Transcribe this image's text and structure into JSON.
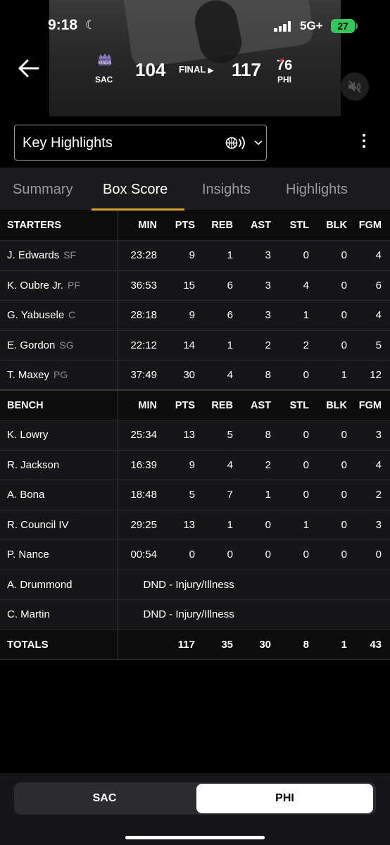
{
  "status": {
    "time": "9:18",
    "network": "5G+",
    "battery": "27"
  },
  "game": {
    "away_abbr": "SAC",
    "away_score": "104",
    "status": "FINAL",
    "home_score": "117",
    "home_abbr": "PHI"
  },
  "dropdown": {
    "label": "Key Highlights"
  },
  "tabs": [
    "Summary",
    "Box Score",
    "Insights",
    "Highlights"
  ],
  "columns": [
    "MIN",
    "PTS",
    "REB",
    "AST",
    "STL",
    "BLK",
    "FGM"
  ],
  "starters_label": "STARTERS",
  "starters": [
    {
      "name": "J. Edwards",
      "pos": "SF",
      "stats": [
        "23:28",
        "9",
        "1",
        "3",
        "0",
        "0",
        "4"
      ]
    },
    {
      "name": "K. Oubre Jr.",
      "pos": "PF",
      "stats": [
        "36:53",
        "15",
        "6",
        "3",
        "4",
        "0",
        "6"
      ]
    },
    {
      "name": "G. Yabusele",
      "pos": "C",
      "stats": [
        "28:18",
        "9",
        "6",
        "3",
        "1",
        "0",
        "4"
      ]
    },
    {
      "name": "E. Gordon",
      "pos": "SG",
      "stats": [
        "22:12",
        "14",
        "1",
        "2",
        "2",
        "0",
        "5"
      ]
    },
    {
      "name": "T. Maxey",
      "pos": "PG",
      "stats": [
        "37:49",
        "30",
        "4",
        "8",
        "0",
        "1",
        "12"
      ]
    }
  ],
  "bench_label": "BENCH",
  "bench": [
    {
      "name": "K. Lowry",
      "stats": [
        "25:34",
        "13",
        "5",
        "8",
        "0",
        "0",
        "3"
      ]
    },
    {
      "name": "R. Jackson",
      "stats": [
        "16:39",
        "9",
        "4",
        "2",
        "0",
        "0",
        "4"
      ]
    },
    {
      "name": "A. Bona",
      "stats": [
        "18:48",
        "5",
        "7",
        "1",
        "0",
        "0",
        "2"
      ]
    },
    {
      "name": "R. Council IV",
      "stats": [
        "29:25",
        "13",
        "1",
        "0",
        "1",
        "0",
        "3"
      ]
    },
    {
      "name": "P. Nance",
      "stats": [
        "00:54",
        "0",
        "0",
        "0",
        "0",
        "0",
        "0"
      ]
    },
    {
      "name": "A. Drummond",
      "dnd": "DND - Injury/Illness"
    },
    {
      "name": "C. Martin",
      "dnd": "DND - Injury/Illness"
    }
  ],
  "totals_label": "TOTALS",
  "totals": [
    "",
    "117",
    "35",
    "30",
    "8",
    "1",
    "43"
  ],
  "team_toggle": {
    "away": "SAC",
    "home": "PHI"
  },
  "colors": {
    "accent": "#d5a32a",
    "battery": "#34c759"
  }
}
